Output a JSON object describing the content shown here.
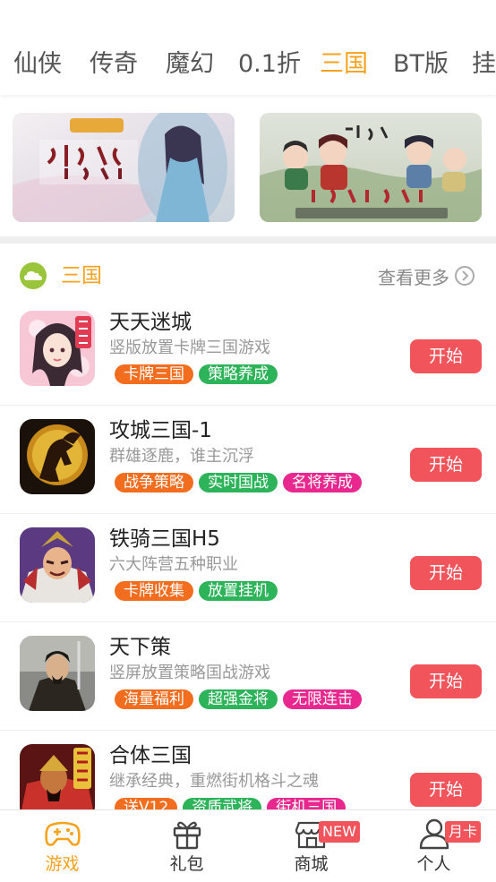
{
  "tabs": [
    "仙侠",
    "传奇",
    "魔幻",
    "0.1折",
    "三国",
    "BT版",
    "挂"
  ],
  "active_tab_index": 4,
  "section": {
    "title": "三国",
    "more_label": "查看更多"
  },
  "games": [
    {
      "name": "天天迷城",
      "desc": "竖版放置卡牌三国游戏",
      "tags": [
        {
          "label": "卡牌三国",
          "color": "#f36d1e"
        },
        {
          "label": "策略养成",
          "color": "#2db35a"
        }
      ],
      "button": "开始"
    },
    {
      "name": "攻城三国-1",
      "desc": "群雄逐鹿，谁主沉浮",
      "tags": [
        {
          "label": "战争策略",
          "color": "#f36d1e"
        },
        {
          "label": "实时国战",
          "color": "#2db35a"
        },
        {
          "label": "名将养成",
          "color": "#e8288e"
        }
      ],
      "button": "开始"
    },
    {
      "name": "铁骑三国H5",
      "desc": "六大阵营五种职业",
      "tags": [
        {
          "label": "卡牌收集",
          "color": "#f36d1e"
        },
        {
          "label": "放置挂机",
          "color": "#2db35a"
        }
      ],
      "button": "开始"
    },
    {
      "name": "天下策",
      "desc": "竖屏放置策略国战游戏",
      "tags": [
        {
          "label": "海量福利",
          "color": "#f36d1e"
        },
        {
          "label": "超强金将",
          "color": "#2db35a"
        },
        {
          "label": "无限连击",
          "color": "#e8288e"
        }
      ],
      "button": "开始"
    },
    {
      "name": "合体三国",
      "desc": "继承经典，重燃街机格斗之魂",
      "tags": [
        {
          "label": "送V12",
          "color": "#f36d1e"
        },
        {
          "label": "资质武将",
          "color": "#2db35a"
        },
        {
          "label": "街机三国",
          "color": "#e8288e"
        }
      ],
      "button": "开始"
    }
  ],
  "bottom_nav": [
    {
      "label": "游戏",
      "icon": "gamepad-icon",
      "active": true
    },
    {
      "label": "礼包",
      "icon": "gift-icon",
      "active": false
    },
    {
      "label": "商城",
      "icon": "store-icon",
      "active": false,
      "badge": "NEW"
    },
    {
      "label": "个人",
      "icon": "user-icon",
      "active": false,
      "badge": "月卡"
    }
  ],
  "colors": {
    "accent": "#f6a21c",
    "button": "#f2545b",
    "section_icon": "#9ac43a"
  }
}
